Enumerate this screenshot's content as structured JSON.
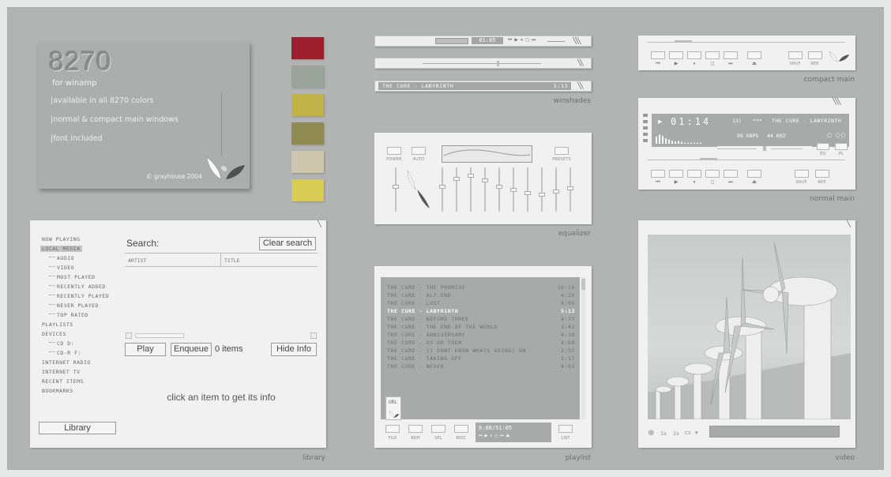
{
  "labels": {
    "winshades": "winshades",
    "compact_main": "compact main",
    "normal_main": "normal main",
    "equalizer": "equalizer",
    "library": "library",
    "playlist": "playlist",
    "video": "video"
  },
  "promo": {
    "title": "8270",
    "subtitle": "for winamp",
    "lines": [
      "|available in all 8270 colors",
      "|normal & compact main windows",
      "|font included"
    ],
    "credit": "© grayhouse 2004"
  },
  "swatches": [
    "#9c1f2e",
    "#9aa49a",
    "#c2b24a",
    "#8e8a52",
    "#cfc6ae",
    "#d8cb55"
  ],
  "winshades": {
    "time": "01:05",
    "track_title": "THE CURE - LABYRINTH",
    "track_time": "5:13"
  },
  "compact": {
    "transport": [
      "⏮",
      "▶",
      "⏸",
      "◻",
      "⏭",
      "⏏"
    ],
    "shuf": "SHUF.",
    "rep": "REP."
  },
  "normal": {
    "time": "01:14",
    "track_num": "13)",
    "stars": "***",
    "title": "THE CURE - LABYRINTH",
    "kbps": "99 KBPS",
    "khz": "44 KHZ",
    "eq": "EQ",
    "pl": "PL",
    "shuf": "SHUF.",
    "rep": "REP.",
    "transport": [
      "⏮",
      "▶",
      "⏸",
      "◻",
      "⏭",
      "⏏"
    ]
  },
  "equalizer": {
    "power": "POWER",
    "auto": "AUTO",
    "presets": "PRESETS"
  },
  "library": {
    "nav": [
      {
        "label": "NOW PLAYING",
        "level": 0
      },
      {
        "label": "LOCAL MEDIA",
        "level": 0,
        "selected": true
      },
      {
        "label": "AUDIO",
        "level": 1
      },
      {
        "label": "VIDEO",
        "level": 1
      },
      {
        "label": "MOST PLAYED",
        "level": 1
      },
      {
        "label": "RECENTLY ADDED",
        "level": 1
      },
      {
        "label": "RECENTLY PLAYED",
        "level": 1
      },
      {
        "label": "NEVER PLAYED",
        "level": 1
      },
      {
        "label": "TOP RATED",
        "level": 1
      },
      {
        "label": "PLAYLISTS",
        "level": 0
      },
      {
        "label": "DEVICES",
        "level": 0
      },
      {
        "label": "CD D:",
        "level": 1
      },
      {
        "label": "CD-R F:",
        "level": 1
      },
      {
        "label": "INTERNET RADIO",
        "level": 0
      },
      {
        "label": "INTERNET TV",
        "level": 0
      },
      {
        "label": "RECENT ITEMS",
        "level": 0
      },
      {
        "label": "BOOKMARKS",
        "level": 0
      }
    ],
    "search_label": "Search:",
    "clear_search": "Clear search",
    "col_artist": "ARTIST",
    "col_title": "TITLE",
    "play": "Play",
    "enqueue": "Enqueue",
    "items": "0 items",
    "hide_info": "Hide Info",
    "info_hint": "click an item to get its info",
    "library_button": "Library"
  },
  "playlist": {
    "tracks": [
      {
        "title": "THE CURE - THE PROMISE",
        "time": "10:16"
      },
      {
        "title": "THE CURE - ALT.END",
        "time": "4:29"
      },
      {
        "title": "THE CURE - LOST",
        "time": "4:06"
      },
      {
        "title": "THE CURE - LABYRINTH",
        "time": "5:13",
        "current": true
      },
      {
        "title": "THE CURE - BEFORE THREE",
        "time": "4:37"
      },
      {
        "title": "THE CURE - THE END OF THE WORLD",
        "time": "3:43"
      },
      {
        "title": "THE CURE - ANNIVERSARY",
        "time": "4:19"
      },
      {
        "title": "THE CURE - US OR THEM",
        "time": "4:08"
      },
      {
        "title": "THE CURE - (I DONT KNOW WHATS GOING) ON",
        "time": "2:55"
      },
      {
        "title": "THE CURE - TAKING OFF",
        "time": "3:17"
      },
      {
        "title": "THE CURE - NEVER",
        "time": "4:02"
      }
    ],
    "url": "URL",
    "buttons": [
      "FILE",
      "REM",
      "SEL",
      "MISC"
    ],
    "list": "LIST",
    "time_readout": "0:00/51:05"
  },
  "video": {
    "zoom1": "1x",
    "zoom2": "2x"
  }
}
